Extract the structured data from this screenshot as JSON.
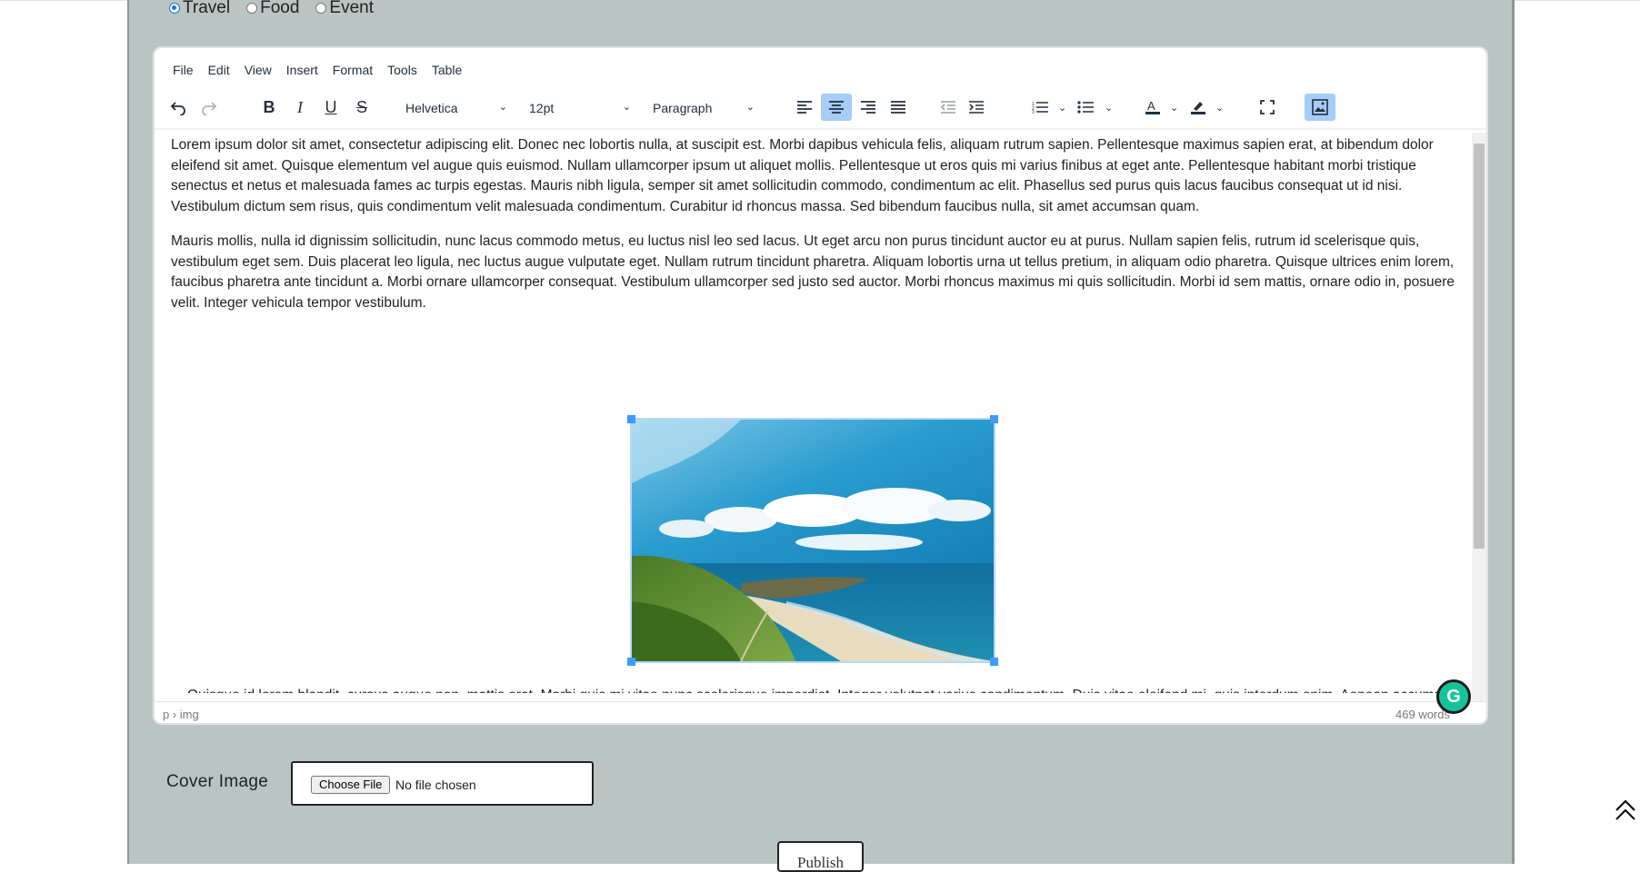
{
  "categories": [
    {
      "label": "Travel",
      "checked": true
    },
    {
      "label": "Food",
      "checked": false
    },
    {
      "label": "Event",
      "checked": false
    }
  ],
  "editor": {
    "menu": [
      "File",
      "Edit",
      "View",
      "Insert",
      "Format",
      "Tools",
      "Table"
    ],
    "toolbar": {
      "font_family": "Helvetica",
      "font_size": "12pt",
      "block_format": "Paragraph",
      "active_color": "#a6ccf7"
    },
    "paragraphs": [
      "Lorem ipsum dolor sit amet, consectetur adipiscing elit. Donec nec lobortis nulla, at suscipit est. Morbi dapibus vehicula felis, aliquam rutrum sapien. Pellentesque maximus sapien erat, at bibendum dolor eleifend sit amet. Quisque elementum vel augue quis euismod. Nullam ullamcorper ipsum ut aliquet mollis. Pellentesque ut eros quis mi varius finibus at eget ante. Pellentesque habitant morbi tristique senectus et netus et malesuada fames ac turpis egestas. Mauris nibh ligula, semper sit amet sollicitudin commodo, condimentum ac elit. Phasellus sed purus quis lacus faucibus consequat ut id nisi. Vestibulum dictum sem risus, quis condimentum velit malesuada condimentum. Curabitur id rhoncus massa. Sed bibendum faucibus nulla, sit amet accumsan quam.",
      "Mauris mollis, nulla id dignissim sollicitudin, nunc lacus commodo metus, eu luctus nisl leo sed lacus. Ut eget arcu non purus tincidunt auctor eu at purus. Nullam sapien felis, rutrum id scelerisque quis, vestibulum eget sem. Duis placerat leo ligula, nec luctus augue vulputate eget. Nullam rutrum tincidunt pharetra. Aliquam lobortis urna ut tellus pretium, in aliquam odio pharetra. Quisque ultrices enim lorem, faucibus pharetra ante tincidunt a. Morbi ornare ullamcorper consequat. Vestibulum ullamcorper sed justo sed auctor. Morbi rhoncus maximus mi quis sollicitudin. Morbi id sem mattis, ornare odio in, posuere velit. Integer vehicula tempor vestibulum.",
      "Quisque id lorem blandit, cursus augue non, mattis erat. Morbi quis mi vitae nunc scelerisque imperdiet. Integer volutpat varius condimentum. Duis vitae eleifend mi, quis interdum enim. Aenean accumsan consequat libero a dignissim. Etiam ultrices pellentesque felis at pulvinar. Praesent sit amet leo quam. Proin et congue metus. Quisque id auctor sapien, nec interdum turpis."
    ],
    "image_icon": "coastal-landscape-photo",
    "status": {
      "path": "p › img",
      "word_count": "469 words"
    }
  },
  "grammarly": {
    "letter": "G",
    "color": "#15c39a"
  },
  "cover": {
    "label": "Cover Image",
    "choose_label": "Choose File",
    "no_file": "No file chosen"
  },
  "publish_label": "Publish",
  "colors": {
    "panel_bg": "#bac4c3",
    "accent": "#4099ff"
  }
}
